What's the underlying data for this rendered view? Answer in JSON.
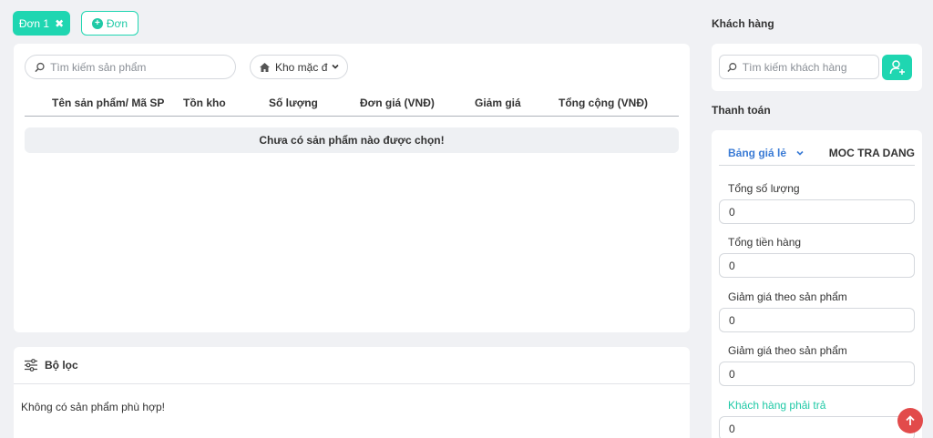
{
  "tabs": {
    "active_label": "Đơn 1",
    "add_label": "Đơn"
  },
  "products": {
    "search_placeholder": "Tìm kiếm sản phẩm",
    "warehouse_label": "Kho mặc đ",
    "columns": [
      "Tên sản phẩm/ Mã SP",
      "Tồn kho",
      "Số lượng",
      "Đơn giá (VNĐ)",
      "Giảm giá",
      "Tổng cộng (VNĐ)"
    ],
    "empty_message": "Chưa có sản phẩm nào được chọn!"
  },
  "filter": {
    "title": "Bộ lọc",
    "empty_message": "Không có sản phẩm phù hợp!"
  },
  "customer": {
    "section_title": "Khách hàng",
    "search_placeholder": "Tìm kiếm khách hàng"
  },
  "payment": {
    "section_title": "Thanh toán",
    "price_list": "Bảng giá lẻ",
    "price_code": "MOC TRA DANG",
    "fields": [
      {
        "label": "Tổng số lượng",
        "value": "0"
      },
      {
        "label": "Tổng tiền hàng",
        "value": "0"
      },
      {
        "label": "Giảm giá theo sản phẩm",
        "value": "0"
      },
      {
        "label": "Giảm giá theo sản phẩm",
        "value": "0"
      },
      {
        "label": "Khách hàng phải trả",
        "value": "0"
      }
    ]
  },
  "colors": {
    "accent": "#1fd6b1",
    "link": "#3a7bd5",
    "scroll_button": "#e24b4b"
  }
}
